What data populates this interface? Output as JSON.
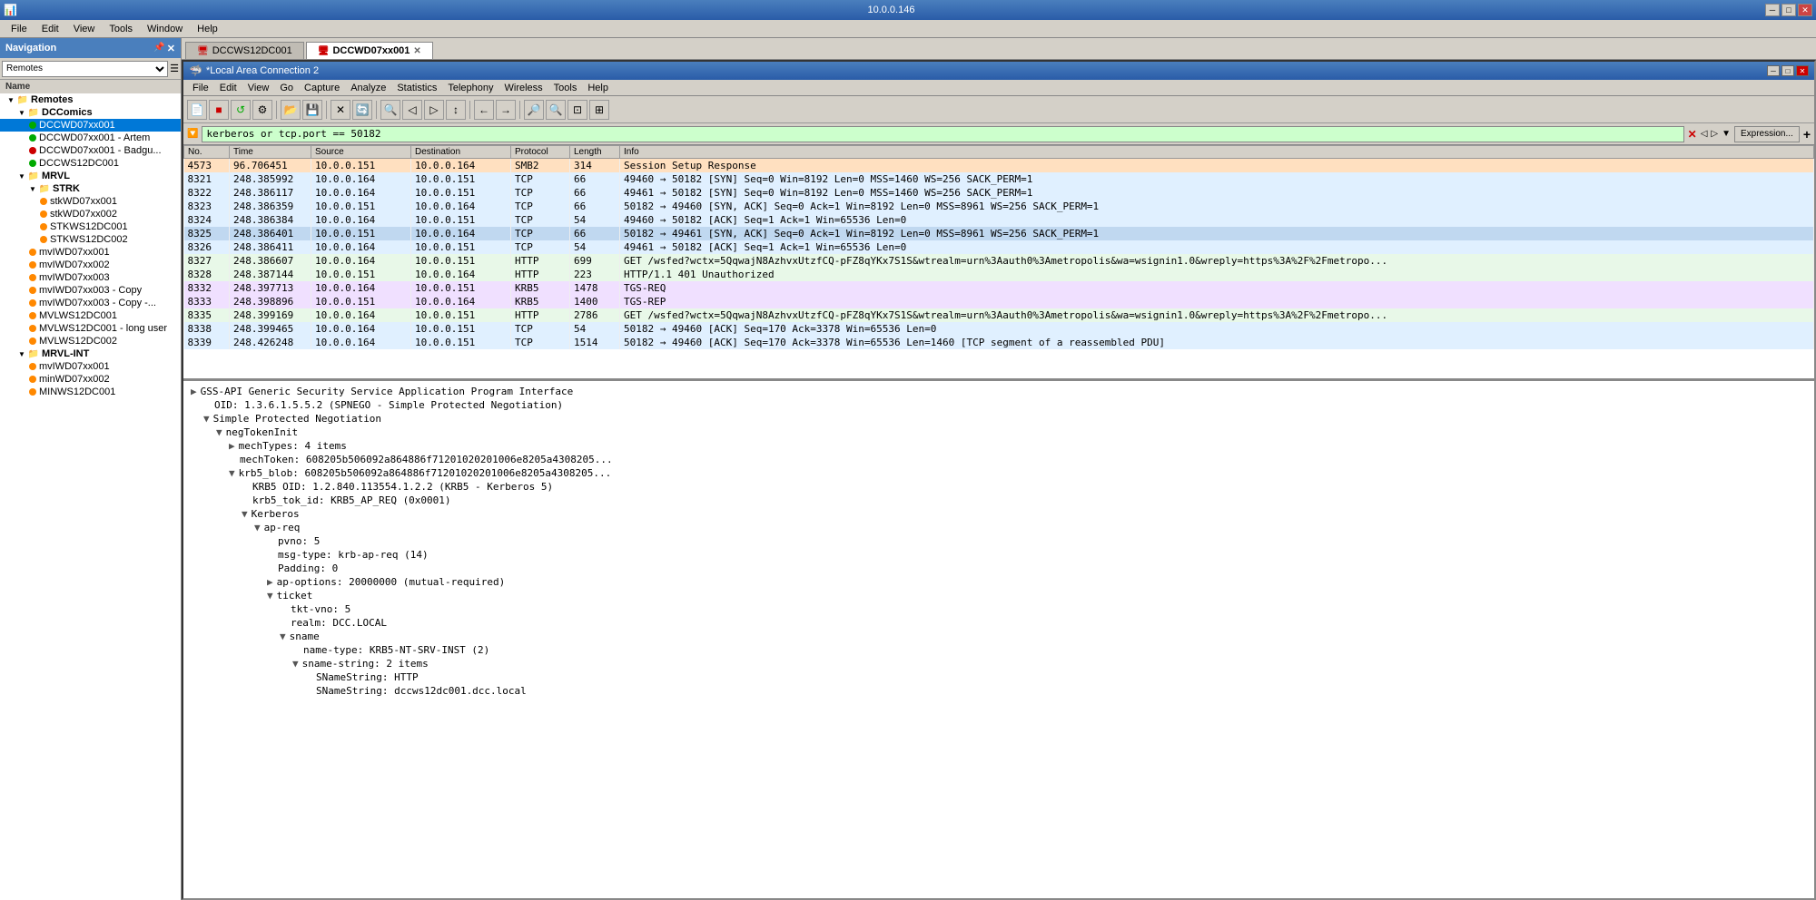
{
  "titleBar": {
    "title": "10.0.0.146",
    "minBtn": "─",
    "maxBtn": "□",
    "closeBtn": "✕"
  },
  "menuBar": {
    "items": [
      "File",
      "Edit",
      "View",
      "Tools",
      "Window",
      "Help"
    ]
  },
  "navigation": {
    "header": "Navigation",
    "dropdown": "Remotes",
    "nameLabel": "Name",
    "remoteLabel": "Remotes",
    "groups": [
      {
        "name": "DCComics",
        "expanded": true,
        "items": [
          {
            "name": "DCCWD07xx001",
            "status": "green",
            "selected": true
          },
          {
            "name": "DCCWD07xx001 - Artem",
            "status": "green"
          },
          {
            "name": "DCCWD07xx001 - Badgu...",
            "status": "red"
          },
          {
            "name": "DCCWS12DC001",
            "status": "green"
          }
        ]
      },
      {
        "name": "MRVL",
        "expanded": true,
        "subgroups": [
          {
            "name": "STRK",
            "expanded": true,
            "items": [
              {
                "name": "stkWD07xx001",
                "status": "orange"
              },
              {
                "name": "stkWD07xx002",
                "status": "orange"
              },
              {
                "name": "STKWS12DC001",
                "status": "orange"
              },
              {
                "name": "STKWS12DC002",
                "status": "orange"
              }
            ]
          }
        ],
        "items2": [
          {
            "name": "mvIWD07xx001",
            "status": "orange"
          },
          {
            "name": "mvIWD07xx002",
            "status": "orange"
          },
          {
            "name": "mvIWD07xx003",
            "status": "orange"
          },
          {
            "name": "mvIWD07xx003 - Copy",
            "status": "orange"
          },
          {
            "name": "mvIWD07xx003 - Copy -...",
            "status": "orange"
          },
          {
            "name": "MVLWS12DC001",
            "status": "orange"
          },
          {
            "name": "MVLWS12DC001 - long user",
            "status": "orange"
          },
          {
            "name": "MVLWS12DC002",
            "status": "orange"
          }
        ]
      },
      {
        "name": "MRVL-INT",
        "expanded": true,
        "items": [
          {
            "name": "mvIWD07xx001",
            "status": "orange"
          },
          {
            "name": "minWD07xx002",
            "status": "orange"
          },
          {
            "name": "MINWS12DC001",
            "status": "orange"
          }
        ]
      }
    ]
  },
  "tabs": [
    {
      "id": "tab1",
      "label": "DCCWS12DC001",
      "active": false,
      "closeable": false
    },
    {
      "id": "tab2",
      "label": "DCCWD07xx001",
      "active": true,
      "closeable": true
    }
  ],
  "wireshark": {
    "titleBar": "*Local Area Connection 2",
    "menuItems": [
      "File",
      "Edit",
      "View",
      "Go",
      "Capture",
      "Analyze",
      "Statistics",
      "Telephony",
      "Wireless",
      "Tools",
      "Help"
    ],
    "filterValue": "kerberos or tcp.port == 50182",
    "filterExpression": "Expression...",
    "columns": [
      "No.",
      "Time",
      "Source",
      "Destination",
      "Protocol",
      "Length",
      "Info"
    ],
    "packets": [
      {
        "no": "4573",
        "time": "96.706451",
        "src": "10.0.0.151",
        "dst": "10.0.0.164",
        "proto": "SMB2",
        "len": "314",
        "info": "Session Setup Response",
        "rowClass": "row-smb"
      },
      {
        "no": "8321",
        "time": "248.385992",
        "src": "10.0.0.164",
        "dst": "10.0.0.151",
        "proto": "TCP",
        "len": "66",
        "info": "49460 → 50182 [SYN] Seq=0 Win=8192 Len=0 MSS=1460 WS=256 SACK_PERM=1",
        "rowClass": "row-tcp"
      },
      {
        "no": "8322",
        "time": "248.386117",
        "src": "10.0.0.164",
        "dst": "10.0.0.151",
        "proto": "TCP",
        "len": "66",
        "info": "49461 → 50182 [SYN] Seq=0 Win=8192 Len=0 MSS=1460 WS=256 SACK_PERM=1",
        "rowClass": "row-tcp"
      },
      {
        "no": "8323",
        "time": "248.386359",
        "src": "10.0.0.151",
        "dst": "10.0.0.164",
        "proto": "TCP",
        "len": "66",
        "info": "50182 → 49460 [SYN, ACK] Seq=0 Ack=1 Win=8192 Len=0 MSS=8961 WS=256 SACK_PERM=1",
        "rowClass": "row-tcp"
      },
      {
        "no": "8324",
        "time": "248.386384",
        "src": "10.0.0.164",
        "dst": "10.0.0.151",
        "proto": "TCP",
        "len": "54",
        "info": "49460 → 50182 [ACK] Seq=1 Ack=1 Win=65536 Len=0",
        "rowClass": "row-tcp"
      },
      {
        "no": "8325",
        "time": "248.386401",
        "src": "10.0.0.151",
        "dst": "10.0.0.164",
        "proto": "TCP",
        "len": "66",
        "info": "50182 → 49461 [SYN, ACK] Seq=0 Ack=1 Win=8192 Len=0 MSS=8961 WS=256 SACK_PERM=1",
        "rowClass": "row-selected"
      },
      {
        "no": "8326",
        "time": "248.386411",
        "src": "10.0.0.164",
        "dst": "10.0.0.151",
        "proto": "TCP",
        "len": "54",
        "info": "49461 → 50182 [ACK] Seq=1 Ack=1 Win=65536 Len=0",
        "rowClass": "row-tcp"
      },
      {
        "no": "8327",
        "time": "248.386607",
        "src": "10.0.0.164",
        "dst": "10.0.0.151",
        "proto": "HTTP",
        "len": "699",
        "info": "GET /wsfed?wctx=5QqwajN8AzhvxUtzfCQ-pFZ8qYKx7S1S&wtrealm=urn%3Aauth0%3Ametropolis&wa=wsignin1.0&wreply=https%3A%2F%2Fmetropo...",
        "rowClass": "row-http"
      },
      {
        "no": "8328",
        "time": "248.387144",
        "src": "10.0.0.151",
        "dst": "10.0.0.164",
        "proto": "HTTP",
        "len": "223",
        "info": "HTTP/1.1 401 Unauthorized",
        "rowClass": "row-http"
      },
      {
        "no": "8332",
        "time": "248.397713",
        "src": "10.0.0.164",
        "dst": "10.0.0.151",
        "proto": "KRB5",
        "len": "1478",
        "info": "TGS-REQ",
        "rowClass": "row-krb"
      },
      {
        "no": "8333",
        "time": "248.398896",
        "src": "10.0.0.151",
        "dst": "10.0.0.164",
        "proto": "KRB5",
        "len": "1400",
        "info": "TGS-REP",
        "rowClass": "row-krb"
      },
      {
        "no": "8335",
        "time": "248.399169",
        "src": "10.0.0.164",
        "dst": "10.0.0.151",
        "proto": "HTTP",
        "len": "2786",
        "info": "GET /wsfed?wctx=5QqwajN8AzhvxUtzfCQ-pFZ8qYKx7S1S&wtrealm=urn%3Aauth0%3Ametropolis&wa=wsignin1.0&wreply=https%3A%2F%2Fmetropo...",
        "rowClass": "row-http"
      },
      {
        "no": "8338",
        "time": "248.399465",
        "src": "10.0.0.164",
        "dst": "10.0.0.151",
        "proto": "TCP",
        "len": "54",
        "info": "50182 → 49460 [ACK] Seq=170 Ack=3378 Win=65536 Len=0",
        "rowClass": "row-tcp"
      },
      {
        "no": "8339",
        "time": "248.426248",
        "src": "10.0.0.164",
        "dst": "10.0.0.151",
        "proto": "TCP",
        "len": "1514",
        "info": "50182 → 49460 [ACK] Seq=170 Ack=3378 Win=65536 Len=1460 [TCP segment of a reassembled PDU]",
        "rowClass": "row-tcp"
      }
    ],
    "detailLines": [
      {
        "indent": 0,
        "expand": "▶",
        "text": "GSS-API Generic Security Service Application Program Interface"
      },
      {
        "indent": 1,
        "expand": "",
        "text": "OID: 1.3.6.1.5.5.2 (SPNEGO - Simple Protected Negotiation)"
      },
      {
        "indent": 1,
        "expand": "▼",
        "text": "Simple Protected Negotiation"
      },
      {
        "indent": 2,
        "expand": "▼",
        "text": "negTokenInit"
      },
      {
        "indent": 3,
        "expand": "▶",
        "text": "mechTypes: 4 items"
      },
      {
        "indent": 3,
        "expand": "",
        "text": "mechToken: 608205b506092a864886f71201020201006e8205a4308205..."
      },
      {
        "indent": 3,
        "expand": "▼",
        "text": "krb5_blob: 608205b506092a864886f71201020201006e8205a4308205..."
      },
      {
        "indent": 4,
        "expand": "",
        "text": "KRB5 OID: 1.2.840.113554.1.2.2 (KRB5 - Kerberos 5)"
      },
      {
        "indent": 4,
        "expand": "",
        "text": "krb5_tok_id: KRB5_AP_REQ (0x0001)"
      },
      {
        "indent": 4,
        "expand": "▼",
        "text": "Kerberos"
      },
      {
        "indent": 5,
        "expand": "▼",
        "text": "ap-req"
      },
      {
        "indent": 6,
        "expand": "",
        "text": "pvno: 5"
      },
      {
        "indent": 6,
        "expand": "",
        "text": "msg-type: krb-ap-req (14)"
      },
      {
        "indent": 6,
        "expand": "",
        "text": "Padding: 0"
      },
      {
        "indent": 6,
        "expand": "▶",
        "text": "ap-options: 20000000 (mutual-required)"
      },
      {
        "indent": 6,
        "expand": "▼",
        "text": "ticket"
      },
      {
        "indent": 7,
        "expand": "",
        "text": "tkt-vno: 5"
      },
      {
        "indent": 7,
        "expand": "",
        "text": "realm: DCC.LOCAL"
      },
      {
        "indent": 7,
        "expand": "▼",
        "text": "sname"
      },
      {
        "indent": 8,
        "expand": "",
        "text": "name-type: KRB5-NT-SRV-INST (2)"
      },
      {
        "indent": 8,
        "expand": "▼",
        "text": "sname-string: 2 items"
      },
      {
        "indent": 9,
        "expand": "",
        "text": "SNameString: HTTP"
      },
      {
        "indent": 9,
        "expand": "",
        "text": "SNameString: dccws12dc001.dcc.local"
      }
    ]
  }
}
